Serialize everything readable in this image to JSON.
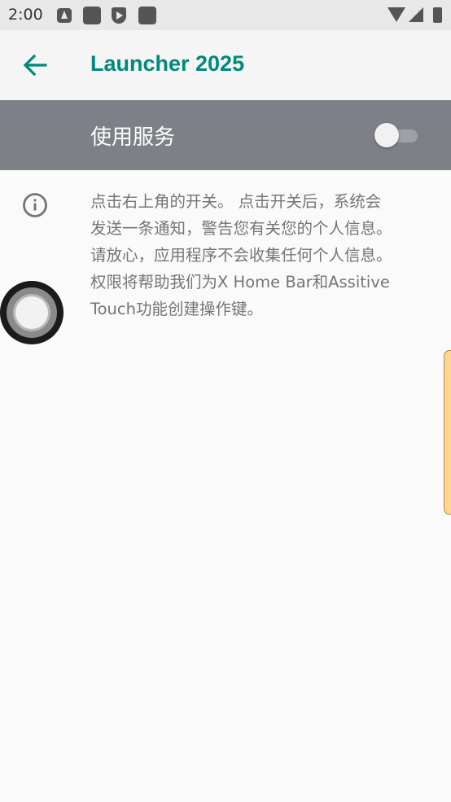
{
  "status_bar": {
    "time": "2:00",
    "icons": [
      "text-notification-icon",
      "app-notification-icon",
      "play-protect-icon",
      "app-notification-icon",
      "wifi-icon",
      "cell-signal-icon",
      "battery-icon"
    ]
  },
  "app_bar": {
    "title": "Launcher 2025",
    "back_icon": "arrow-back-icon",
    "accent_color": "#00897b"
  },
  "service": {
    "label": "使用服务",
    "toggle_on": false,
    "bar_color": "#7e8087"
  },
  "info": {
    "icon": "info-icon",
    "lines": [
      "点击右上角的开关。 点击开关后，系统会",
      "发送一条通知，警告您有关您的个人信息。",
      "请放心，应用程序不会收集任何个人信息。",
      "权限将帮助我们为X Home Bar和Assitive",
      "Touch功能创建操作键。"
    ]
  },
  "overlays": {
    "floating_button": "assistive-touch-button",
    "edge_handle": "edge-panel-handle",
    "edge_color": "#ffd58f"
  }
}
